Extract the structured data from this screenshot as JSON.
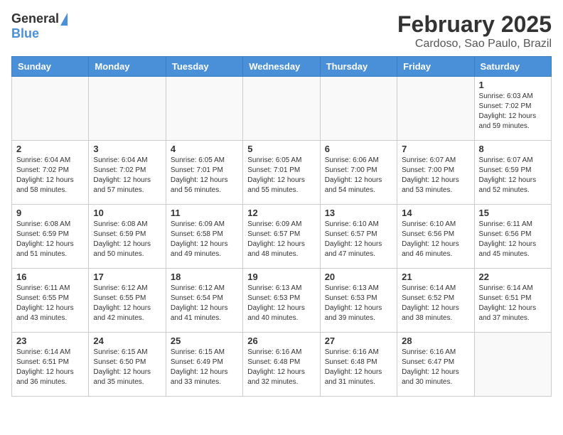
{
  "header": {
    "logo_general": "General",
    "logo_blue": "Blue",
    "title": "February 2025",
    "subtitle": "Cardoso, Sao Paulo, Brazil"
  },
  "weekdays": [
    "Sunday",
    "Monday",
    "Tuesday",
    "Wednesday",
    "Thursday",
    "Friday",
    "Saturday"
  ],
  "weeks": [
    [
      {
        "day": "",
        "info": ""
      },
      {
        "day": "",
        "info": ""
      },
      {
        "day": "",
        "info": ""
      },
      {
        "day": "",
        "info": ""
      },
      {
        "day": "",
        "info": ""
      },
      {
        "day": "",
        "info": ""
      },
      {
        "day": "1",
        "info": "Sunrise: 6:03 AM\nSunset: 7:02 PM\nDaylight: 12 hours\nand 59 minutes."
      }
    ],
    [
      {
        "day": "2",
        "info": "Sunrise: 6:04 AM\nSunset: 7:02 PM\nDaylight: 12 hours\nand 58 minutes."
      },
      {
        "day": "3",
        "info": "Sunrise: 6:04 AM\nSunset: 7:02 PM\nDaylight: 12 hours\nand 57 minutes."
      },
      {
        "day": "4",
        "info": "Sunrise: 6:05 AM\nSunset: 7:01 PM\nDaylight: 12 hours\nand 56 minutes."
      },
      {
        "day": "5",
        "info": "Sunrise: 6:05 AM\nSunset: 7:01 PM\nDaylight: 12 hours\nand 55 minutes."
      },
      {
        "day": "6",
        "info": "Sunrise: 6:06 AM\nSunset: 7:00 PM\nDaylight: 12 hours\nand 54 minutes."
      },
      {
        "day": "7",
        "info": "Sunrise: 6:07 AM\nSunset: 7:00 PM\nDaylight: 12 hours\nand 53 minutes."
      },
      {
        "day": "8",
        "info": "Sunrise: 6:07 AM\nSunset: 6:59 PM\nDaylight: 12 hours\nand 52 minutes."
      }
    ],
    [
      {
        "day": "9",
        "info": "Sunrise: 6:08 AM\nSunset: 6:59 PM\nDaylight: 12 hours\nand 51 minutes."
      },
      {
        "day": "10",
        "info": "Sunrise: 6:08 AM\nSunset: 6:59 PM\nDaylight: 12 hours\nand 50 minutes."
      },
      {
        "day": "11",
        "info": "Sunrise: 6:09 AM\nSunset: 6:58 PM\nDaylight: 12 hours\nand 49 minutes."
      },
      {
        "day": "12",
        "info": "Sunrise: 6:09 AM\nSunset: 6:57 PM\nDaylight: 12 hours\nand 48 minutes."
      },
      {
        "day": "13",
        "info": "Sunrise: 6:10 AM\nSunset: 6:57 PM\nDaylight: 12 hours\nand 47 minutes."
      },
      {
        "day": "14",
        "info": "Sunrise: 6:10 AM\nSunset: 6:56 PM\nDaylight: 12 hours\nand 46 minutes."
      },
      {
        "day": "15",
        "info": "Sunrise: 6:11 AM\nSunset: 6:56 PM\nDaylight: 12 hours\nand 45 minutes."
      }
    ],
    [
      {
        "day": "16",
        "info": "Sunrise: 6:11 AM\nSunset: 6:55 PM\nDaylight: 12 hours\nand 43 minutes."
      },
      {
        "day": "17",
        "info": "Sunrise: 6:12 AM\nSunset: 6:55 PM\nDaylight: 12 hours\nand 42 minutes."
      },
      {
        "day": "18",
        "info": "Sunrise: 6:12 AM\nSunset: 6:54 PM\nDaylight: 12 hours\nand 41 minutes."
      },
      {
        "day": "19",
        "info": "Sunrise: 6:13 AM\nSunset: 6:53 PM\nDaylight: 12 hours\nand 40 minutes."
      },
      {
        "day": "20",
        "info": "Sunrise: 6:13 AM\nSunset: 6:53 PM\nDaylight: 12 hours\nand 39 minutes."
      },
      {
        "day": "21",
        "info": "Sunrise: 6:14 AM\nSunset: 6:52 PM\nDaylight: 12 hours\nand 38 minutes."
      },
      {
        "day": "22",
        "info": "Sunrise: 6:14 AM\nSunset: 6:51 PM\nDaylight: 12 hours\nand 37 minutes."
      }
    ],
    [
      {
        "day": "23",
        "info": "Sunrise: 6:14 AM\nSunset: 6:51 PM\nDaylight: 12 hours\nand 36 minutes."
      },
      {
        "day": "24",
        "info": "Sunrise: 6:15 AM\nSunset: 6:50 PM\nDaylight: 12 hours\nand 35 minutes."
      },
      {
        "day": "25",
        "info": "Sunrise: 6:15 AM\nSunset: 6:49 PM\nDaylight: 12 hours\nand 33 minutes."
      },
      {
        "day": "26",
        "info": "Sunrise: 6:16 AM\nSunset: 6:48 PM\nDaylight: 12 hours\nand 32 minutes."
      },
      {
        "day": "27",
        "info": "Sunrise: 6:16 AM\nSunset: 6:48 PM\nDaylight: 12 hours\nand 31 minutes."
      },
      {
        "day": "28",
        "info": "Sunrise: 6:16 AM\nSunset: 6:47 PM\nDaylight: 12 hours\nand 30 minutes."
      },
      {
        "day": "",
        "info": ""
      }
    ]
  ]
}
